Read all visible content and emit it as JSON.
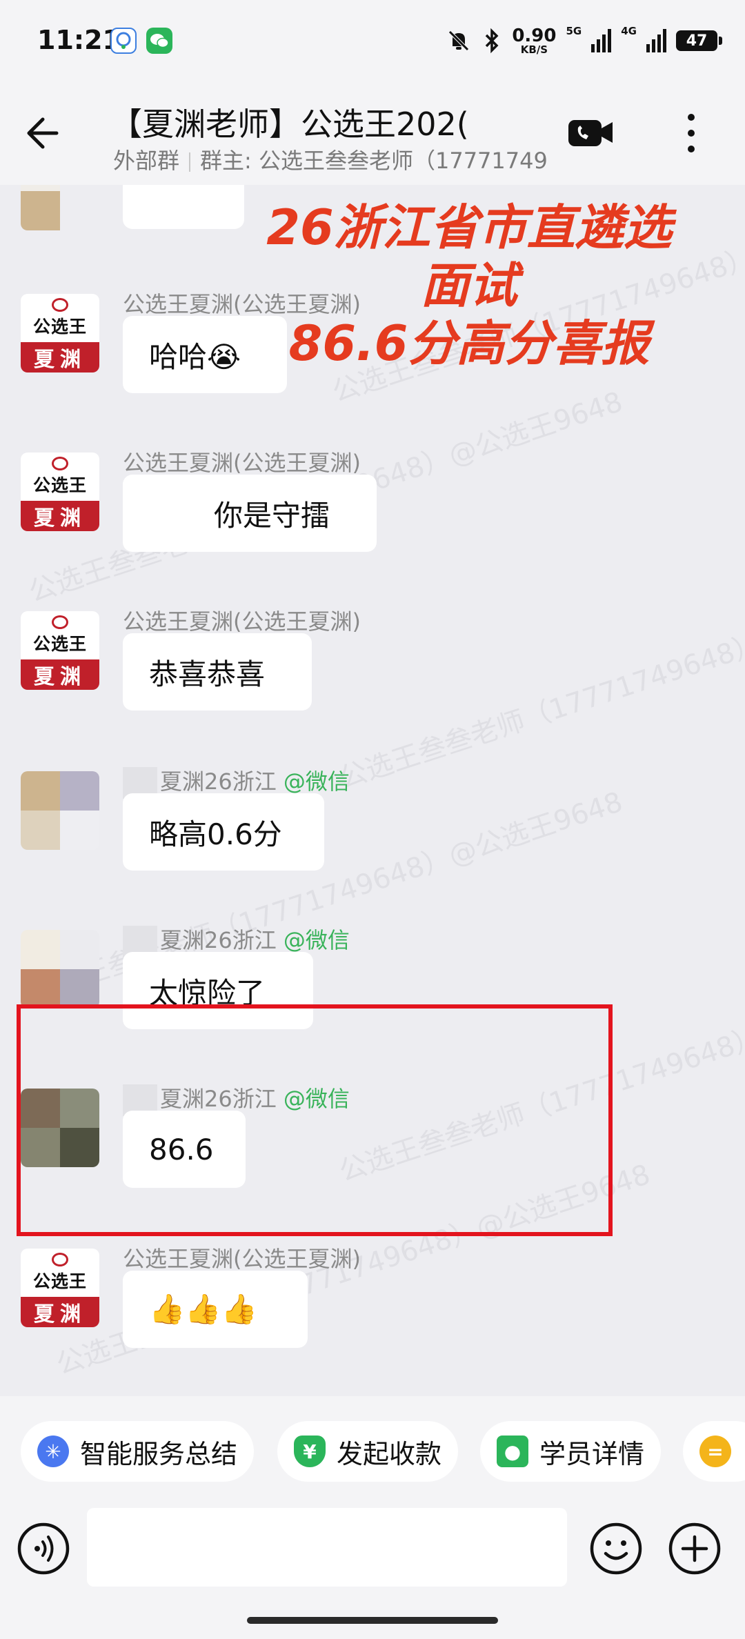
{
  "status_bar": {
    "time": "11:21",
    "net_speed_value": "0.90",
    "net_speed_unit": "KB/S",
    "net_5g": "5G",
    "net_4g": "4G",
    "battery": "47",
    "icons": [
      "qq-icon",
      "wechat-icon",
      "mute-icon",
      "bluetooth-icon",
      "signal-icon",
      "battery-icon"
    ]
  },
  "header": {
    "title": "【夏渊老师】公选王202(",
    "group_type": "外部群",
    "owner": "群主: 公选王叁叁老师（17771749"
  },
  "banner": {
    "line1": "26浙江省市直遴选面试",
    "line2": "86.6分高分喜报"
  },
  "watermark": "公选王叁叁老师（17771749648）@公选王9648",
  "messages": [
    {
      "sender": "",
      "text": "",
      "avatar": "mosaic"
    },
    {
      "sender": "公选王夏渊(公选王夏渊)",
      "text": "哈哈😭",
      "avatar": "logo"
    },
    {
      "sender": "公选王夏渊(公选王夏渊)",
      "text": "你是守擂",
      "avatar": "logo"
    },
    {
      "sender": "公选王夏渊(公选王夏渊)",
      "text": "恭喜恭喜",
      "avatar": "logo"
    },
    {
      "sender": "夏渊26浙江",
      "sender_tag": "@微信",
      "text": "略高0.6分",
      "avatar": "mosaic"
    },
    {
      "sender": "夏渊26浙江",
      "sender_tag": "@微信",
      "text": "太惊险了",
      "avatar": "mosaic"
    },
    {
      "sender": "夏渊26浙江",
      "sender_tag": "@微信",
      "text": "86.6",
      "avatar": "mosaic"
    },
    {
      "sender": "公选王夏渊(公选王夏渊)",
      "text": "👍👍👍",
      "avatar": "logo"
    }
  ],
  "avatar_logo": {
    "brand": "公选王",
    "name": "夏渊"
  },
  "quick_actions": [
    {
      "label": "智能服务总结",
      "icon": "sparkle-icon",
      "color": "#4a78f0"
    },
    {
      "label": "发起收款",
      "icon": "yuan-shield-icon",
      "color": "#2bb55a"
    },
    {
      "label": "学员详情",
      "icon": "user-card-icon",
      "color": "#2bb55a"
    },
    {
      "label": "",
      "icon": "chat-note-icon",
      "color": "#f4b41a"
    }
  ],
  "input": {
    "placeholder": ""
  },
  "colors": {
    "banner": "#e53b1f",
    "highlight_box": "#e3141e",
    "logo_red": "#c0202a",
    "wechat_tag": "#39b35a"
  }
}
